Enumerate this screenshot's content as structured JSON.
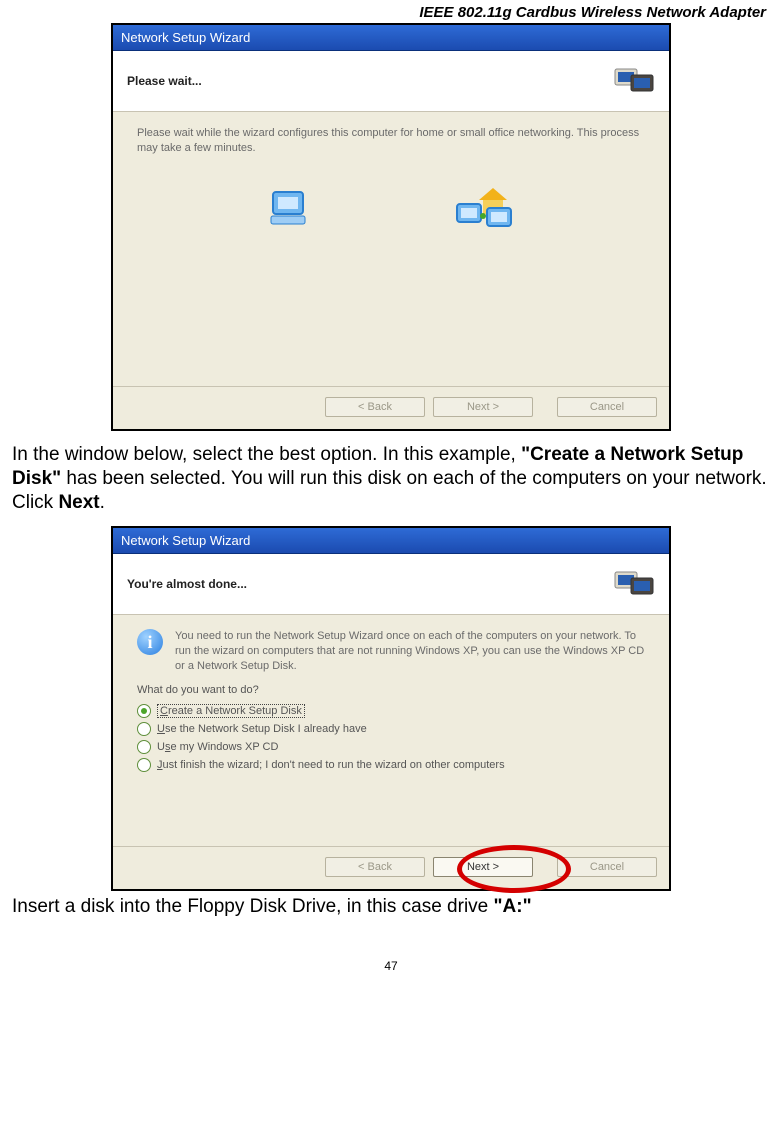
{
  "header": "IEEE 802.11g Cardbus Wireless Network Adapter",
  "page_number": "47",
  "para1_pre": "In the window below, select the best option. In this example, ",
  "para1_bold1": "\"Create a Network Setup Disk\"",
  "para1_mid": " has been selected. You will run this disk on each of the computers on your network. Click ",
  "para1_bold2": "Next",
  "para1_end": ".",
  "para2_pre": "Insert a disk into the Floppy Disk Drive, in this case drive ",
  "para2_bold": "\"A:\"",
  "wizard1": {
    "titlebar": "Network Setup Wizard",
    "subtitle": "Please wait...",
    "desc": "Please wait while the wizard configures this computer for home or small office networking. This process may take a few minutes.",
    "buttons": {
      "back": "< Back",
      "next": "Next >",
      "cancel": "Cancel"
    }
  },
  "wizard2": {
    "titlebar": "Network Setup Wizard",
    "subtitle": "You're almost done...",
    "info_text": "You need to run the Network Setup Wizard once on each of the computers on your network. To run the wizard on computers that are not running Windows XP, you can use the Windows XP CD or a Network Setup Disk.",
    "question": "What do you want to do?",
    "options": [
      {
        "label_pre": "",
        "ul": "C",
        "label_post": "reate a Network Setup Disk",
        "selected": true,
        "boxed": true
      },
      {
        "label_pre": "",
        "ul": "U",
        "label_post": "se the Network Setup Disk I already have",
        "selected": false,
        "boxed": false
      },
      {
        "label_pre": "U",
        "ul": "s",
        "label_post": "e my Windows XP CD",
        "selected": false,
        "boxed": false
      },
      {
        "label_pre": "",
        "ul": "J",
        "label_post": "ust finish the wizard; I don't need to run the wizard on other computers",
        "selected": false,
        "boxed": false
      }
    ],
    "buttons": {
      "back": "< Back",
      "next": "Next >",
      "cancel": "Cancel"
    }
  }
}
